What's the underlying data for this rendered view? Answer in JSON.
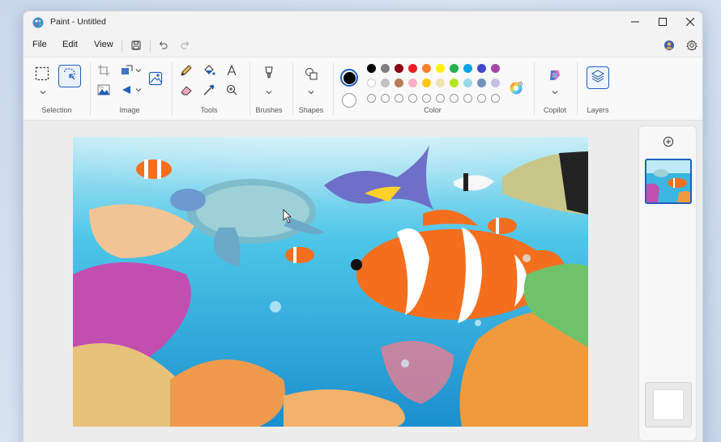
{
  "window": {
    "title": "Paint - Untitled"
  },
  "menu": {
    "file": "File",
    "edit": "Edit",
    "view": "View"
  },
  "ribbon": {
    "groups": {
      "selection": "Selection",
      "image": "Image",
      "tools": "Tools",
      "brushes": "Brushes",
      "shapes": "Shapes",
      "color": "Color",
      "copilot": "Copilot",
      "layers": "Layers"
    }
  },
  "colors": {
    "primary": "#000000",
    "secondary": "#ffffff",
    "palette_row1": [
      "#000000",
      "#7f7f7f",
      "#880015",
      "#ed1c24",
      "#ff7f27",
      "#fff200",
      "#22b14c",
      "#00a2e8",
      "#3f48cc",
      "#a349a4"
    ],
    "palette_row2": [
      "#ffffff",
      "#c3c3c3",
      "#b97a57",
      "#ffaec9",
      "#ffc90e",
      "#efe4b0",
      "#b5e61d",
      "#99d9ea",
      "#7092be",
      "#c8bfe7"
    ],
    "accent": "#1f5fbf"
  },
  "icons": {
    "app": "paint-icon",
    "save": "save-icon",
    "undo": "undo-icon",
    "redo": "redo-icon",
    "profile": "profile-icon",
    "settings": "gear-icon",
    "add_layer": "plus-circle-icon"
  }
}
